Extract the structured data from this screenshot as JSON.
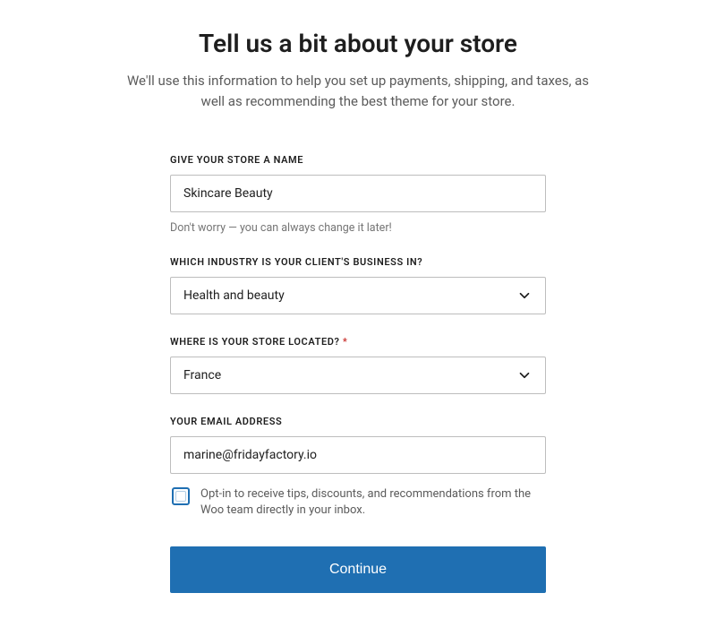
{
  "heading": "Tell us a bit about your store",
  "subheading": "We'll use this information to help you set up payments, shipping, and taxes, as well as recommending the best theme for your store.",
  "fields": {
    "store_name": {
      "label": "GIVE YOUR STORE A NAME",
      "value": "Skincare Beauty",
      "hint": "Don't worry — you can always change it later!"
    },
    "industry": {
      "label": "WHICH INDUSTRY IS YOUR CLIENT'S BUSINESS IN?",
      "value": "Health and beauty"
    },
    "location": {
      "label": "WHERE IS YOUR STORE LOCATED?",
      "required_marker": "*",
      "value": "France"
    },
    "email": {
      "label": "YOUR EMAIL ADDRESS",
      "value": "marine@fridayfactory.io"
    }
  },
  "opt_in_text": "Opt-in to receive tips, discounts, and recommendations from the Woo team directly in your inbox.",
  "continue_label": "Continue",
  "colors": {
    "primary": "#1f6fb2",
    "text_muted": "#5b5b5b",
    "border": "#bdbdbd"
  }
}
